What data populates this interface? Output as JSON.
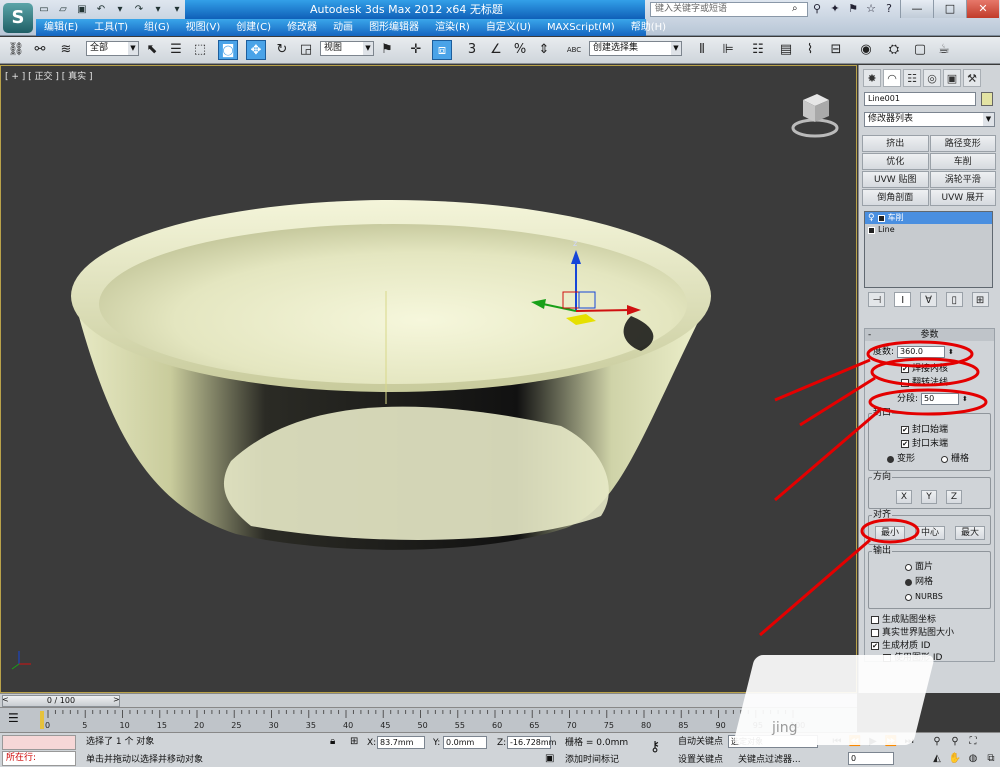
{
  "app": {
    "logo_letter": "S",
    "title_text": "Autodesk 3ds Max  2012 x64    无标题",
    "search_placeholder": "键入关键字或短语",
    "window_controls": [
      "—",
      "□",
      "✕"
    ]
  },
  "menu": [
    "编辑(E)",
    "工具(T)",
    "组(G)",
    "视图(V)",
    "创建(C)",
    "修改器",
    "动画",
    "图形编辑器",
    "渲染(R)",
    "自定义(U)",
    "MAXScript(M)",
    "帮助(H)"
  ],
  "toolbar": {
    "selection_filter": "全部",
    "reference_coord": "视图",
    "named_selection": "创建选择集",
    "snap_label": "3",
    "percent_snap": "%",
    "abc_label": "ABC"
  },
  "viewport": {
    "label": "[ + ] [ 正交 ] [ 真实 ]",
    "gizmo_label": "z"
  },
  "command_panel": {
    "object_name": "Line001",
    "object_color": "#e3e3a3",
    "modifier_list": "修改器列表",
    "modifier_buttons": [
      "挤出",
      "路径变形",
      "优化",
      "车削",
      "UVW 贴图",
      "涡轮平滑",
      "倒角剖面",
      "UVW 展开"
    ],
    "stack": [
      {
        "label": "车削",
        "selected": true
      },
      {
        "label": "Line",
        "selected": false
      }
    ],
    "params": {
      "rollout_title": "参数",
      "degrees_label": "度数:",
      "degrees_value": "360.0",
      "weld_core": "焊接内核",
      "weld_core_checked": true,
      "flip_normals": "翻转法线",
      "flip_normals_checked": false,
      "segments_label": "分段:",
      "segments_value": "50",
      "capping_group": "封口",
      "cap_start": "封口始端",
      "cap_end": "封口末端",
      "morph": "变形",
      "grid": "栅格",
      "direction_group": "方向",
      "dir_x": "X",
      "dir_y": "Y",
      "dir_z": "Z",
      "align_group": "对齐",
      "align_min": "最小",
      "align_center": "中心",
      "align_max": "最大",
      "output_group": "输出",
      "out_patch": "面片",
      "out_mesh": "网格",
      "out_nurbs": "NURBS",
      "gen_map_coords": "生成贴图坐标",
      "real_world_map": "真实世界贴图大小",
      "gen_mat_ids": "生成材质 ID",
      "use_shape_ids": "使用图形 ID"
    }
  },
  "timeline": {
    "frame_display": "0 / 100",
    "ticks": [
      "0",
      "5",
      "10",
      "15",
      "20",
      "25",
      "30",
      "35",
      "40",
      "45",
      "50",
      "55",
      "60",
      "65",
      "70",
      "75",
      "80",
      "85",
      "90",
      "95",
      "100"
    ]
  },
  "status": {
    "listener_text": "所在行:",
    "selected_msg": "选择了 1 个 对象",
    "prompt_msg": "单击并拖动以选择并移动对象",
    "x_label": "X:",
    "x_value": "83.7mm",
    "y_label": "Y:",
    "y_value": "0.0mm",
    "z_label": "Z:",
    "z_value": "-16.728mm",
    "grid_label": "栅格 = 0.0mm",
    "add_time_tag": "添加时间标记",
    "auto_key": "自动关键点",
    "set_key": "设置关键点",
    "key_mode": "选定对象",
    "key_filters": "关键点过滤器...",
    "frame_field": "0"
  },
  "watermark": "jing"
}
